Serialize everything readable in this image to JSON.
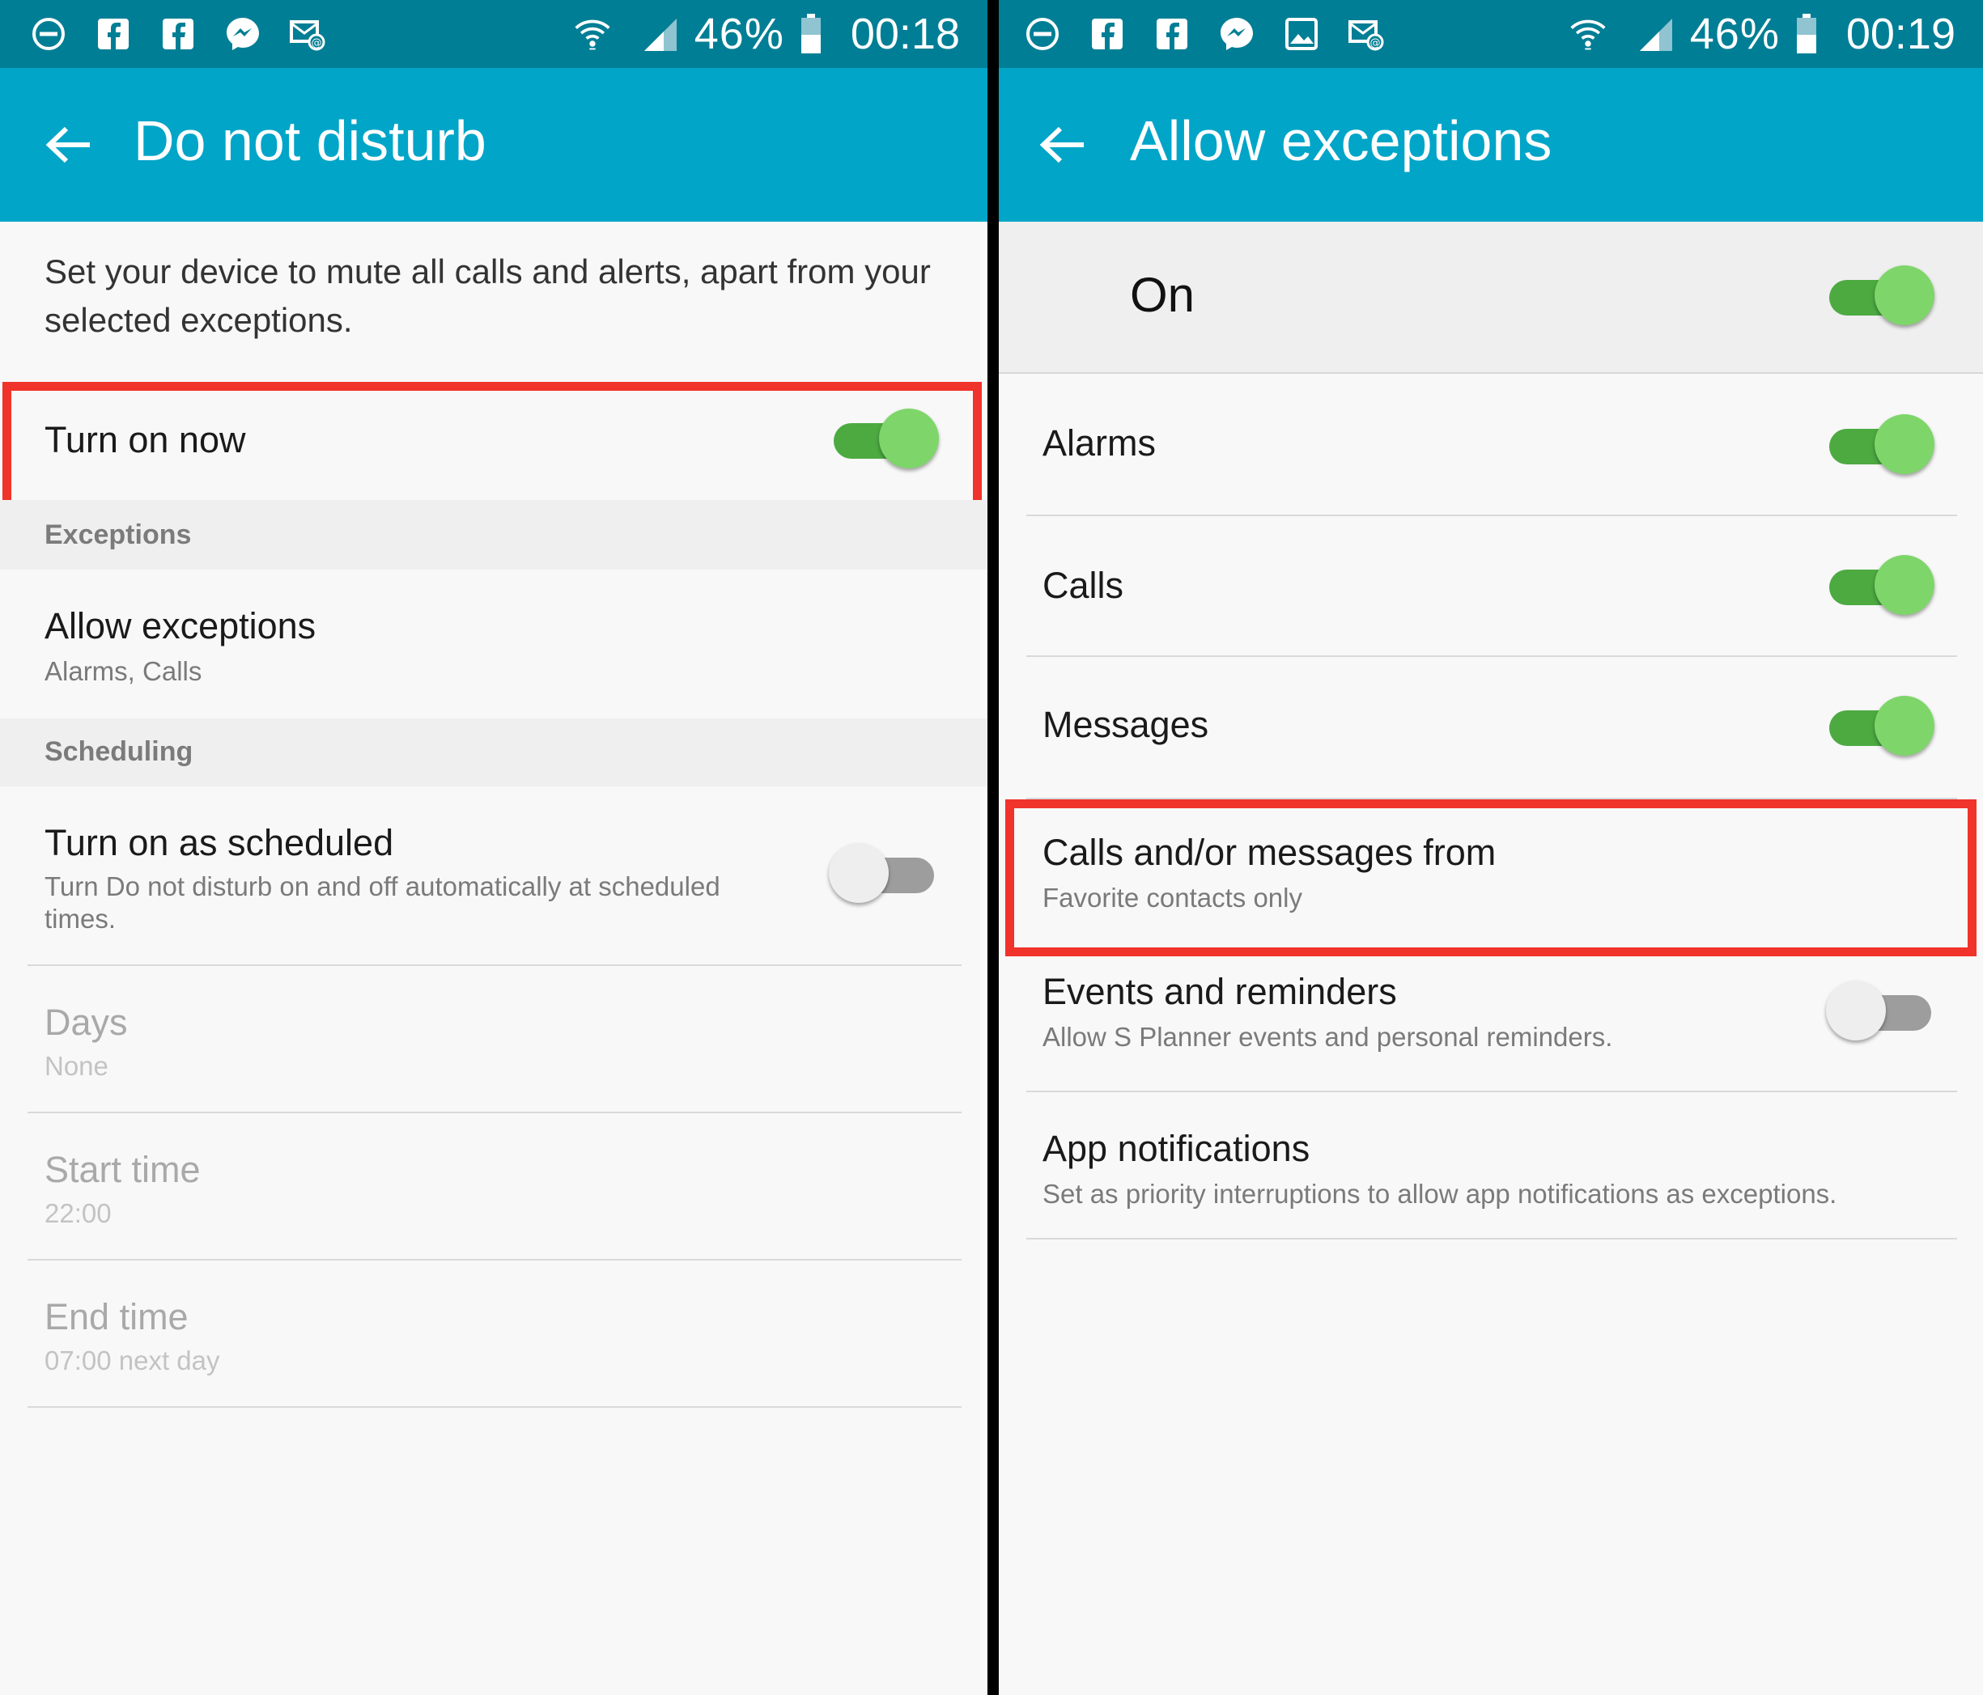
{
  "colors": {
    "status_bar": "#007e95",
    "app_bar": "#00a5c8",
    "toggle_on_track": "#4caa41",
    "toggle_on_knob": "#7ed66a",
    "toggle_off_track": "#9d9d9d",
    "toggle_off_knob": "#eeeeee",
    "highlight": "#f0332b"
  },
  "left": {
    "status_bar": {
      "icons": [
        "do-not-disturb-icon",
        "facebook-icon",
        "facebook-icon",
        "messenger-icon",
        "email-icon"
      ],
      "right_icons": [
        "wifi-icon",
        "signal-icon",
        "battery-icon"
      ],
      "battery": "46%",
      "time": "00:18"
    },
    "app_bar": {
      "title": "Do not disturb",
      "back_icon": "back-arrow-icon"
    },
    "description": "Set your device to mute all calls and alerts, apart from your selected exceptions.",
    "turn_on_now": {
      "label": "Turn on now",
      "on": true
    },
    "exceptions_header": "Exceptions",
    "allow_exceptions": {
      "title": "Allow exceptions",
      "subtitle": "Alarms, Calls"
    },
    "scheduling_header": "Scheduling",
    "scheduled": {
      "title": "Turn on as scheduled",
      "subtitle": "Turn Do not disturb on and off automatically at scheduled times.",
      "on": false
    },
    "days": {
      "title": "Days",
      "value": "None"
    },
    "start_time": {
      "title": "Start time",
      "value": "22:00"
    },
    "end_time": {
      "title": "End time",
      "value": "07:00 next day"
    }
  },
  "right": {
    "status_bar": {
      "icons": [
        "do-not-disturb-icon",
        "facebook-icon",
        "facebook-icon",
        "messenger-icon",
        "gallery-icon",
        "email-icon"
      ],
      "right_icons": [
        "wifi-icon",
        "signal-icon",
        "battery-icon"
      ],
      "battery": "46%",
      "time": "00:19"
    },
    "app_bar": {
      "title": "Allow exceptions",
      "back_icon": "back-arrow-icon"
    },
    "master": {
      "label": "On",
      "on": true
    },
    "items": [
      {
        "title": "Alarms",
        "on": true
      },
      {
        "title": "Calls",
        "on": true
      },
      {
        "title": "Messages",
        "on": true
      }
    ],
    "calls_messages_from": {
      "title": "Calls and/or messages from",
      "subtitle": "Favorite contacts only"
    },
    "events": {
      "title": "Events and reminders",
      "subtitle": "Allow S Planner events and personal reminders.",
      "on": false
    },
    "app_notifications": {
      "title": "App notifications",
      "subtitle": "Set as priority interruptions to allow app notifications as exceptions."
    }
  }
}
